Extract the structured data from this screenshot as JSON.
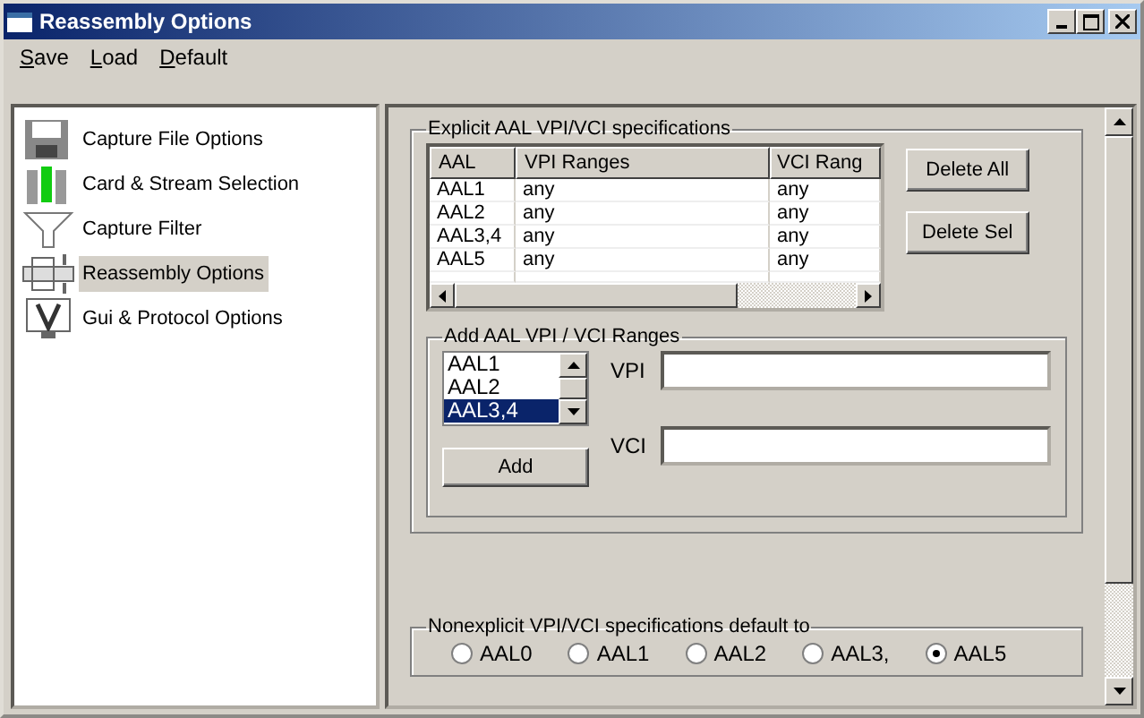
{
  "window": {
    "title": "Reassembly Options"
  },
  "menu": [
    "Save",
    "Load",
    "Default"
  ],
  "sidebar": {
    "items": [
      {
        "label": "Capture File Options",
        "selected": false
      },
      {
        "label": "Card & Stream Selection",
        "selected": false
      },
      {
        "label": "Capture Filter",
        "selected": false
      },
      {
        "label": "Reassembly Options",
        "selected": true
      },
      {
        "label": "Gui & Protocol Options",
        "selected": false
      }
    ]
  },
  "explicit_group": {
    "title": "Explicit AAL VPI/VCI specifications",
    "table": {
      "columns": [
        "AAL",
        "VPI Ranges",
        "VCI Rang"
      ],
      "rows": [
        [
          "AAL1",
          "any",
          "any"
        ],
        [
          "AAL2",
          "any",
          "any"
        ],
        [
          "AAL3,4",
          "any",
          "any"
        ],
        [
          "AAL5",
          "any",
          "any"
        ]
      ]
    },
    "buttons": [
      "Delete All",
      "Delete Sel"
    ],
    "add_group": {
      "title": "Add AAL VPI / VCI Ranges",
      "aal_list": [
        {
          "label": "AAL1",
          "selected": false
        },
        {
          "label": "AAL2",
          "selected": false
        },
        {
          "label": "AAL3,4",
          "selected": true
        }
      ],
      "add_button": "Add",
      "fields": [
        {
          "label": "VPI"
        },
        {
          "label": "VCI"
        }
      ]
    }
  },
  "default_group": {
    "title": "Nonexplicit VPI/VCI specifications default to",
    "options": [
      {
        "label": "AAL0",
        "selected": false
      },
      {
        "label": "AAL1",
        "selected": false
      },
      {
        "label": "AAL2",
        "selected": false
      },
      {
        "label": "AAL3,",
        "selected": false
      },
      {
        "label": "AAL5",
        "selected": true
      }
    ]
  }
}
